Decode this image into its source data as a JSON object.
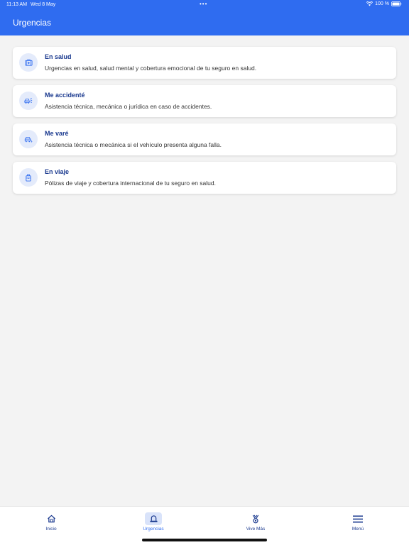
{
  "status_bar": {
    "time": "11:13 AM",
    "date": "Wed 8 May",
    "dots": "•••",
    "battery": "100 %"
  },
  "header": {
    "title": "Urgencias"
  },
  "cards": [
    {
      "icon": "medical-kit-icon",
      "title": "En salud",
      "description": "Urgencias en salud, salud mental y cobertura emocional de tu seguro en salud."
    },
    {
      "icon": "car-crash-icon",
      "title": "Me accidenté",
      "description": "Asistencia técnica, mecánica o jurídica en caso de accidentes."
    },
    {
      "icon": "car-breakdown-icon",
      "title": "Me varé",
      "description": "Asistencia técnica o mecánica si el vehículo presenta alguna falla."
    },
    {
      "icon": "luggage-icon",
      "title": "En viaje",
      "description": "Pólizas de viaje y cobertura internacional de tu seguro en salud."
    }
  ],
  "tabs": [
    {
      "icon": "home-icon",
      "label": "Inicio"
    },
    {
      "icon": "siren-icon",
      "label": "Urgencias"
    },
    {
      "icon": "medal-icon",
      "label": "Vive Más"
    },
    {
      "icon": "menu-icon",
      "label": "Menú"
    }
  ],
  "active_tab": "Urgencias",
  "colors": {
    "brand": "#2f6cf0",
    "title_text": "#1b3a8f",
    "background": "#f3f3f3"
  }
}
